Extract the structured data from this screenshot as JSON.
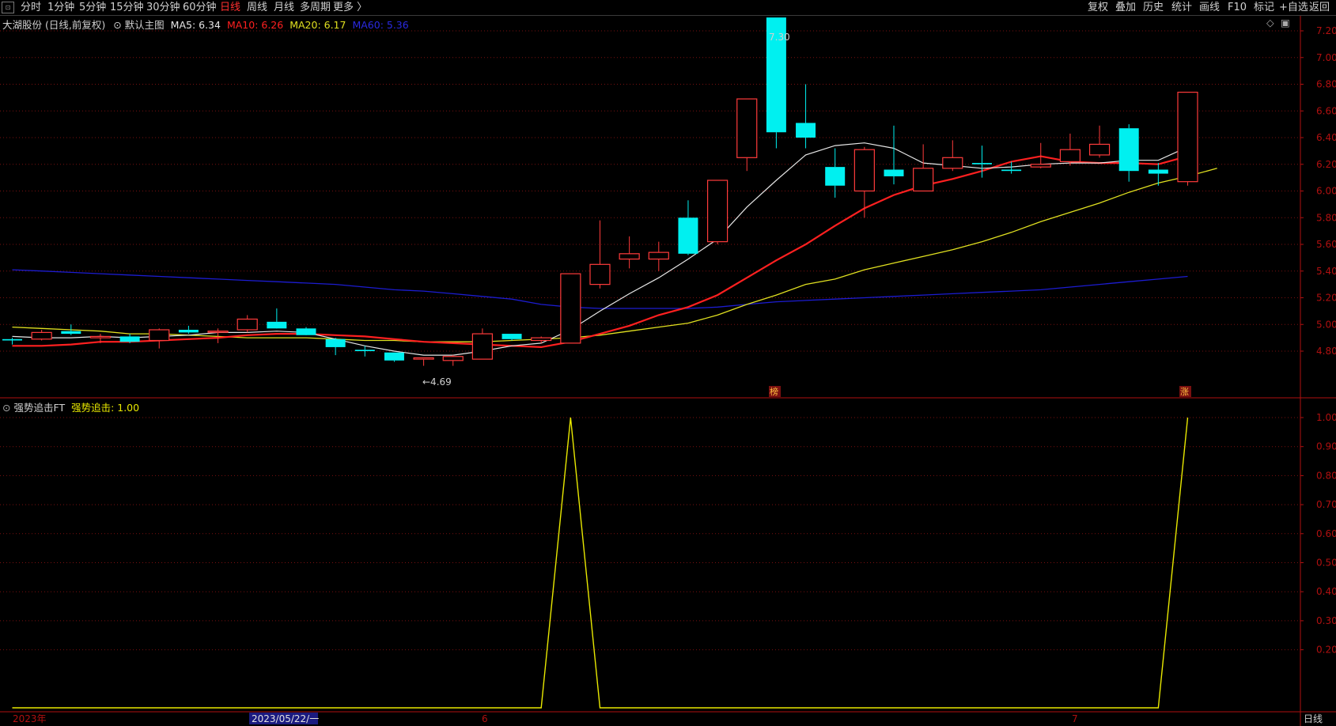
{
  "toolbar": {
    "left_items": [
      "分时",
      "1分钟",
      "5分钟",
      "15分钟",
      "30分钟",
      "60分钟",
      "日线",
      "周线",
      "月线",
      "多周期",
      "更多 〉"
    ],
    "active_item": "日线",
    "right_items": [
      "复权",
      "叠加",
      "历史",
      "统计",
      "画线",
      "F10",
      "标记",
      "+自选",
      "返回"
    ]
  },
  "main_chart": {
    "stock_title": "大湖股份 (日线,前复权)",
    "template_label": "默认主图",
    "ma5_label": "MA5: 6.34",
    "ma10_label": "MA10: 6.26",
    "ma20_label": "MA20: 6.17",
    "ma60_label": "MA60: 5.36",
    "high_annotation": "7.30",
    "low_annotation": "←4.69",
    "marker_bang": "榜",
    "marker_zhang": "涨",
    "corner_icons": [
      "◇",
      "▣"
    ]
  },
  "indicator": {
    "name": "强势追击FT",
    "value_label": "强势追击: 1.00"
  },
  "time_axis": {
    "labels": [
      "2023年",
      "2023/05/22/一",
      "6",
      "7"
    ],
    "period_label": "日线"
  },
  "colors": {
    "up": "#ff3b3b",
    "down": "#00f0f0",
    "ma5": "#e6e6e6",
    "ma10": "#ff2020",
    "ma20": "#e0e020",
    "ma60": "#1c1cd0",
    "indicator_line": "#e8e800",
    "grid": "#7a1010",
    "axis": "#b01010"
  },
  "chart_data": [
    {
      "type": "candlestick",
      "title": "大湖股份 (日线,前复权)",
      "y_ticks": [
        4.8,
        5.0,
        5.2,
        5.4,
        5.6,
        5.8,
        6.0,
        6.2,
        6.4,
        6.6,
        6.8,
        7.0,
        7.2
      ],
      "ylim": [
        4.6,
        7.3
      ],
      "candles": [
        {
          "o": 4.89,
          "h": 4.9,
          "l": 4.85,
          "c": 4.88
        },
        {
          "o": 4.89,
          "h": 4.96,
          "l": 4.88,
          "c": 4.94
        },
        {
          "o": 4.95,
          "h": 5.0,
          "l": 4.92,
          "c": 4.93
        },
        {
          "o": 4.9,
          "h": 4.93,
          "l": 4.86,
          "c": 4.91
        },
        {
          "o": 4.91,
          "h": 4.93,
          "l": 4.86,
          "c": 4.87
        },
        {
          "o": 4.88,
          "h": 4.97,
          "l": 4.82,
          "c": 4.96
        },
        {
          "o": 4.96,
          "h": 4.99,
          "l": 4.93,
          "c": 4.94
        },
        {
          "o": 4.95,
          "h": 4.97,
          "l": 4.86,
          "c": 4.95
        },
        {
          "o": 4.96,
          "h": 5.07,
          "l": 4.94,
          "c": 5.04
        },
        {
          "o": 5.02,
          "h": 5.12,
          "l": 4.98,
          "c": 4.97
        },
        {
          "o": 4.97,
          "h": 4.98,
          "l": 4.93,
          "c": 4.92
        },
        {
          "o": 4.89,
          "h": 4.9,
          "l": 4.77,
          "c": 4.83
        },
        {
          "o": 4.81,
          "h": 4.84,
          "l": 4.76,
          "c": 4.8
        },
        {
          "o": 4.79,
          "h": 4.79,
          "l": 4.72,
          "c": 4.73
        },
        {
          "o": 4.74,
          "h": 4.75,
          "l": 4.69,
          "c": 4.75
        },
        {
          "o": 4.73,
          "h": 4.77,
          "l": 4.69,
          "c": 4.76
        },
        {
          "o": 4.74,
          "h": 4.97,
          "l": 4.74,
          "c": 4.93
        },
        {
          "o": 4.93,
          "h": 4.93,
          "l": 4.88,
          "c": 4.89
        },
        {
          "o": 4.88,
          "h": 4.91,
          "l": 4.86,
          "c": 4.9
        },
        {
          "o": 4.86,
          "h": 5.12,
          "l": 4.86,
          "c": 5.38
        },
        {
          "o": 5.3,
          "h": 5.78,
          "l": 5.27,
          "c": 5.45
        },
        {
          "o": 5.49,
          "h": 5.66,
          "l": 5.42,
          "c": 5.53
        },
        {
          "o": 5.49,
          "h": 5.62,
          "l": 5.4,
          "c": 5.54
        },
        {
          "o": 5.8,
          "h": 5.93,
          "l": 5.52,
          "c": 5.53
        },
        {
          "o": 5.62,
          "h": 6.08,
          "l": 5.6,
          "c": 6.08
        },
        {
          "o": 6.25,
          "h": 6.69,
          "l": 6.15,
          "c": 6.69
        },
        {
          "o": 7.3,
          "h": 7.3,
          "l": 6.32,
          "c": 6.44
        },
        {
          "o": 6.51,
          "h": 6.8,
          "l": 6.32,
          "c": 6.4
        },
        {
          "o": 6.18,
          "h": 6.32,
          "l": 5.95,
          "c": 6.04
        },
        {
          "o": 6.0,
          "h": 6.33,
          "l": 5.8,
          "c": 6.31
        },
        {
          "o": 6.16,
          "h": 6.49,
          "l": 6.05,
          "c": 6.11
        },
        {
          "o": 6.0,
          "h": 6.35,
          "l": 6.0,
          "c": 6.17
        },
        {
          "o": 6.17,
          "h": 6.38,
          "l": 6.15,
          "c": 6.25
        },
        {
          "o": 6.21,
          "h": 6.34,
          "l": 6.1,
          "c": 6.2
        },
        {
          "o": 6.16,
          "h": 6.22,
          "l": 6.13,
          "c": 6.15
        },
        {
          "o": 6.18,
          "h": 6.36,
          "l": 6.17,
          "c": 6.2
        },
        {
          "o": 6.22,
          "h": 6.43,
          "l": 6.19,
          "c": 6.31
        },
        {
          "o": 6.27,
          "h": 6.49,
          "l": 6.25,
          "c": 6.35
        },
        {
          "o": 6.47,
          "h": 6.5,
          "l": 6.07,
          "c": 6.15
        },
        {
          "o": 6.16,
          "h": 6.21,
          "l": 6.04,
          "c": 6.13
        },
        {
          "o": 6.07,
          "h": 6.74,
          "l": 6.04,
          "c": 6.74
        }
      ],
      "ma5": [
        4.91,
        4.9,
        4.9,
        4.91,
        4.9,
        4.91,
        4.92,
        4.94,
        4.94,
        4.95,
        4.94,
        4.89,
        4.84,
        4.8,
        4.77,
        4.77,
        4.8,
        4.84,
        4.86,
        4.96,
        5.1,
        5.23,
        5.35,
        5.49,
        5.64,
        5.88,
        6.08,
        6.27,
        6.34,
        6.36,
        6.32,
        6.21,
        6.19,
        6.17,
        6.18,
        6.2,
        6.21,
        6.21,
        6.23,
        6.23,
        6.33
      ],
      "ma10": [
        4.84,
        4.84,
        4.85,
        4.87,
        4.87,
        4.88,
        4.89,
        4.9,
        4.92,
        4.93,
        4.93,
        4.92,
        4.91,
        4.89,
        4.87,
        4.86,
        4.85,
        4.84,
        4.83,
        4.87,
        4.93,
        4.99,
        5.07,
        5.13,
        5.22,
        5.35,
        5.48,
        5.6,
        5.74,
        5.87,
        5.97,
        6.04,
        6.09,
        6.15,
        6.22,
        6.26,
        6.22,
        6.21,
        6.21,
        6.2,
        6.26
      ],
      "ma20": [
        4.98,
        4.97,
        4.96,
        4.95,
        4.93,
        4.93,
        4.92,
        4.91,
        4.9,
        4.9,
        4.9,
        4.89,
        4.88,
        4.88,
        4.87,
        4.87,
        4.87,
        4.88,
        4.89,
        4.9,
        4.92,
        4.95,
        4.98,
        5.01,
        5.07,
        5.15,
        5.22,
        5.3,
        5.34,
        5.41,
        5.46,
        5.51,
        5.56,
        5.62,
        5.69,
        5.77,
        5.84,
        5.91,
        5.99,
        6.06,
        6.11,
        6.17
      ],
      "ma60": [
        5.41,
        5.4,
        5.39,
        5.38,
        5.37,
        5.36,
        5.35,
        5.34,
        5.33,
        5.32,
        5.31,
        5.3,
        5.28,
        5.26,
        5.25,
        5.23,
        5.21,
        5.19,
        5.15,
        5.13,
        5.12,
        5.12,
        5.12,
        5.12,
        5.13,
        5.15,
        5.17,
        5.18,
        5.19,
        5.2,
        5.21,
        5.22,
        5.23,
        5.24,
        5.25,
        5.26,
        5.28,
        5.3,
        5.32,
        5.34,
        5.36
      ]
    },
    {
      "type": "line",
      "title": "强势追击FT",
      "y_ticks": [
        0.2,
        0.3,
        0.4,
        0.5,
        0.6,
        0.7,
        0.8,
        0.9,
        1.0
      ],
      "ylim": [
        0,
        1
      ],
      "series": [
        {
          "name": "强势追击",
          "values": [
            0,
            0,
            0,
            0,
            0,
            0,
            0,
            0,
            0,
            0,
            0,
            0,
            0,
            0,
            0,
            0,
            0,
            0,
            0,
            1,
            0,
            0,
            0,
            0,
            0,
            0,
            0,
            0,
            0,
            0,
            0,
            0,
            0,
            0,
            0,
            0,
            0,
            0,
            0,
            0,
            1
          ]
        }
      ]
    }
  ]
}
